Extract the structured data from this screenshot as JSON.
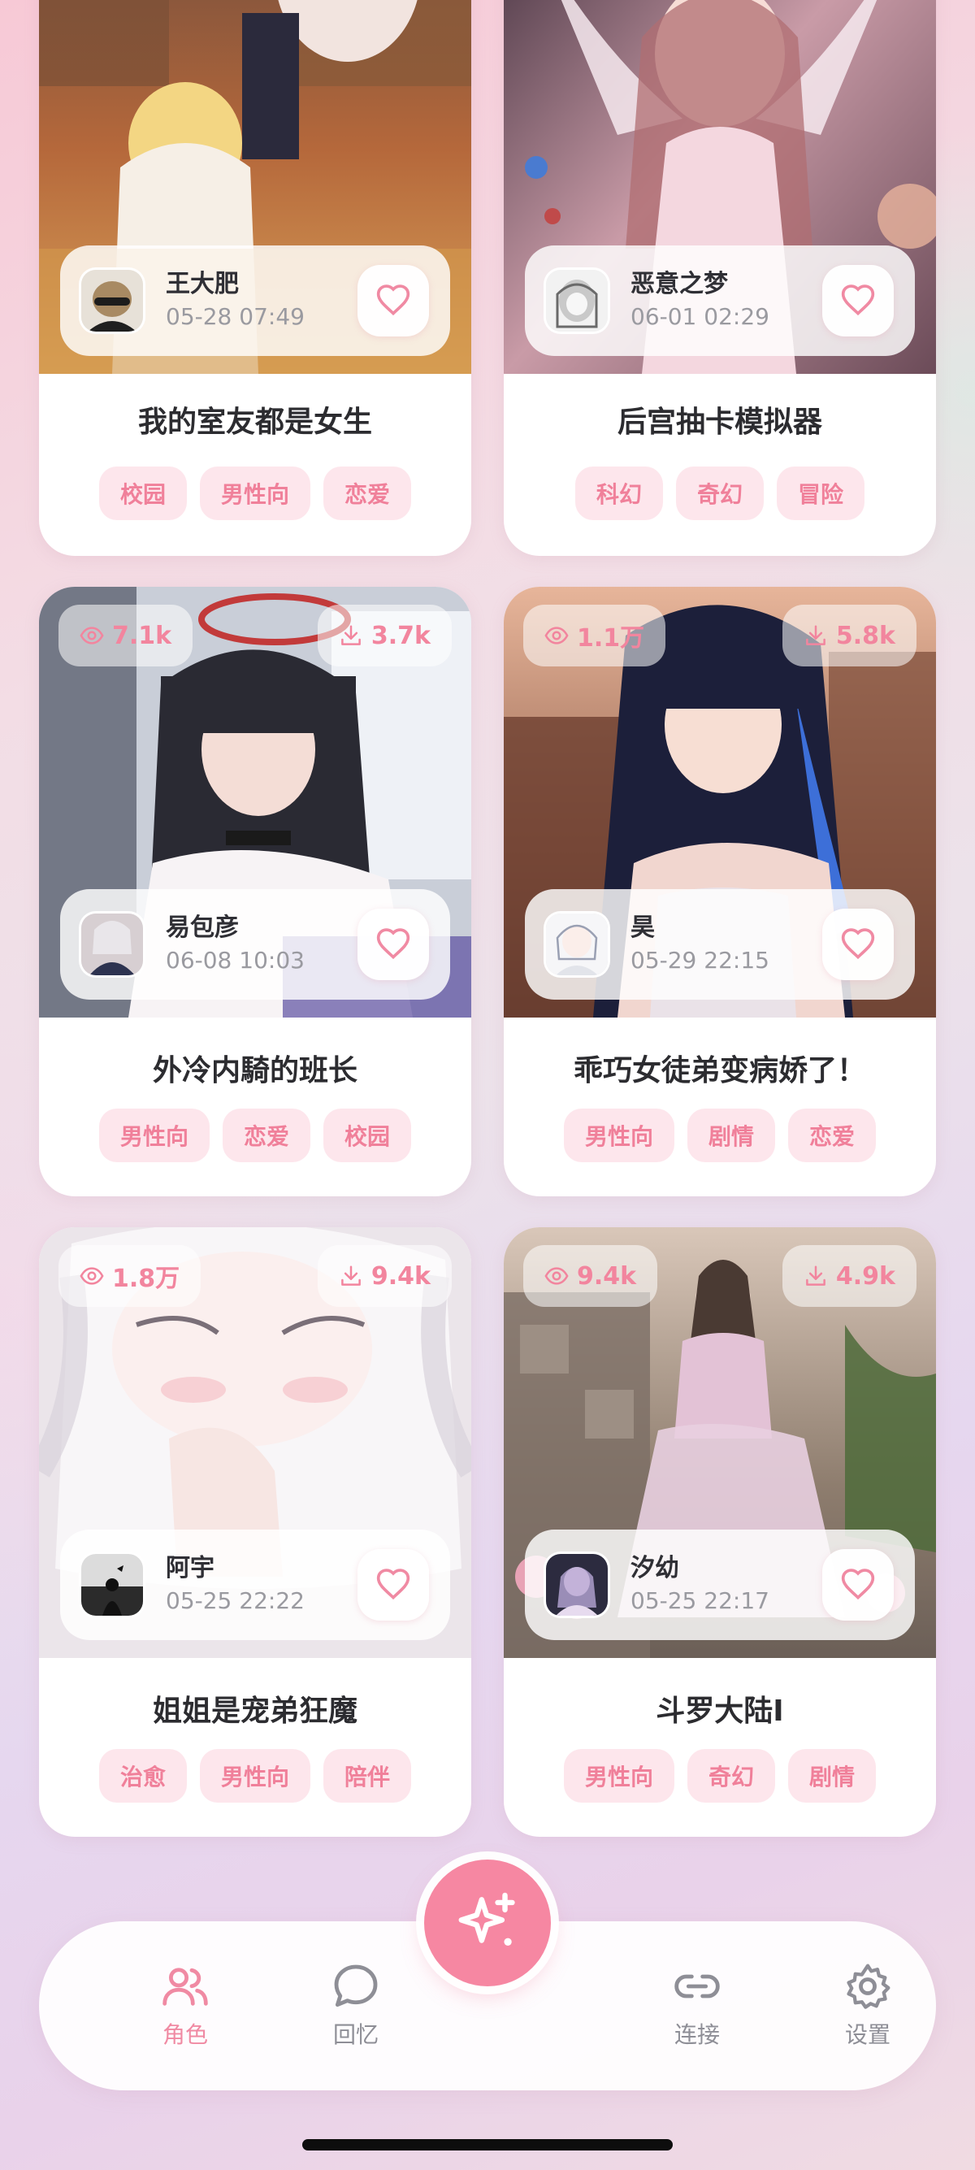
{
  "cards": [
    {
      "views": "",
      "downloads": "",
      "author": "王大肥",
      "time": "05-28 07:49",
      "title": "我的室友都是女生",
      "tags": [
        "校园",
        "男性向",
        "恋爱"
      ]
    },
    {
      "views": "",
      "downloads": "",
      "author": "恶意之梦",
      "time": "06-01 02:29",
      "title": "后宫抽卡模拟器",
      "tags": [
        "科幻",
        "奇幻",
        "冒险"
      ]
    },
    {
      "views": "7.1k",
      "downloads": "3.7k",
      "author": "易包彦",
      "time": "06-08 10:03",
      "title": "外冷内騎的班长",
      "tags": [
        "男性向",
        "恋爱",
        "校园"
      ]
    },
    {
      "views": "1.1万",
      "downloads": "5.8k",
      "author": "昊",
      "time": "05-29 22:15",
      "title": "乖巧女徒弟变病娇了！",
      "tags": [
        "男性向",
        "剧情",
        "恋爱"
      ]
    },
    {
      "views": "1.8万",
      "downloads": "9.4k",
      "author": "阿宇",
      "time": "05-25 22:22",
      "title": "姐姐是宠弟狂魔",
      "tags": [
        "治愈",
        "男性向",
        "陪伴"
      ]
    },
    {
      "views": "9.4k",
      "downloads": "4.9k",
      "author": "汐幼",
      "time": "05-25 22:17",
      "title": "斗罗大陆Ⅰ",
      "tags": [
        "男性向",
        "奇幻",
        "剧情"
      ]
    }
  ],
  "nav": {
    "characters": "角色",
    "memories": "回忆",
    "connect": "连接",
    "settings": "设置"
  },
  "colors": {
    "accent": "#f687a2",
    "tag_bg": "#fde6ec",
    "tag_text": "#f0809a"
  },
  "icons": [
    "eye-icon",
    "download-icon",
    "heart-icon",
    "users-icon",
    "chat-bubble-icon",
    "sparkle-icon",
    "link-icon",
    "gear-icon"
  ]
}
